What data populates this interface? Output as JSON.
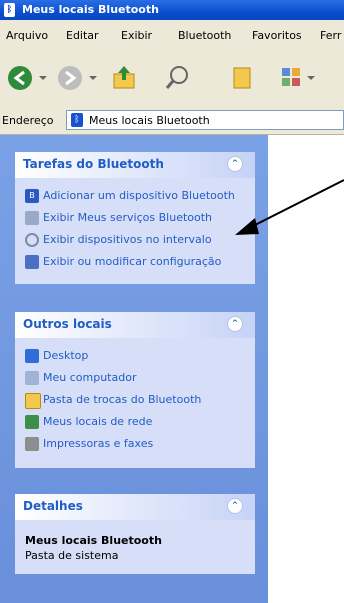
{
  "window": {
    "title": "Meus locais Bluetooth"
  },
  "menu": [
    "Arquivo",
    "Editar",
    "Exibir",
    "Bluetooth",
    "Favoritos",
    "Ferr"
  ],
  "toolbar": {
    "back_icon": "back-arrow-icon",
    "forward_icon": "forward-arrow-icon",
    "up_icon": "folder-up-icon",
    "search_icon": "search-icon",
    "folders_icon": "folders-icon",
    "views_icon": "views-icon"
  },
  "address": {
    "label": "Endereço",
    "value": "Meus locais Bluetooth"
  },
  "panels": {
    "bluetooth_tasks": {
      "title": "Tarefas do Bluetooth",
      "items": [
        {
          "label": "Adicionar um dispositivo Bluetooth",
          "icon": "add-device-icon"
        },
        {
          "label": "Exibir Meus serviços Bluetooth",
          "icon": "services-icon"
        },
        {
          "label": "Exibir dispositivos no intervalo",
          "icon": "search-icon"
        },
        {
          "label": "Exibir ou modificar configuração",
          "icon": "settings-icon"
        }
      ]
    },
    "other_places": {
      "title": "Outros locais",
      "items": [
        {
          "label": "Desktop",
          "icon": "desktop-icon"
        },
        {
          "label": "Meu computador",
          "icon": "computer-icon"
        },
        {
          "label": "Pasta de trocas do Bluetooth",
          "icon": "folder-icon"
        },
        {
          "label": "Meus locais de rede",
          "icon": "network-icon"
        },
        {
          "label": "Impressoras e faxes",
          "icon": "printer-icon"
        }
      ]
    },
    "details": {
      "title": "Detalhes",
      "name": "Meus locais Bluetooth",
      "type": "Pasta de sistema"
    }
  }
}
